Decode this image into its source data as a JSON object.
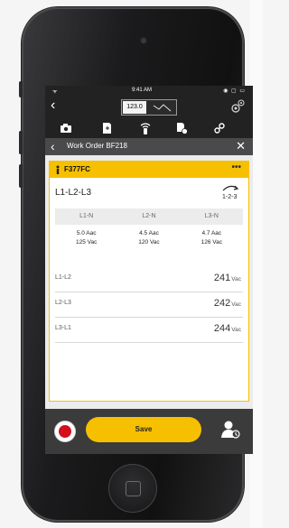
{
  "status_bar": {
    "left": "ᯤ",
    "time": "9:41 AM",
    "right": "◉ ▢ ▭"
  },
  "top_nav": {
    "meter_value": "123.0",
    "back_icon": "chevron-left-icon",
    "waveform_icon": "waveform-icon",
    "settings_icon": "gears-icon"
  },
  "toolbar": {
    "icons": [
      "camera-icon",
      "add-document-icon",
      "wireless-icon",
      "document-sync-icon",
      "link-icon"
    ]
  },
  "breadcrumb": {
    "title": "Work Order BF218"
  },
  "card": {
    "asset_name": "F377FC",
    "more": "•••",
    "phase_title": "L1-L2-L3",
    "rotation_label": "1-2-3",
    "phase_headers": [
      "L1-N",
      "L2-N",
      "L3-N"
    ],
    "phase_values": [
      {
        "current": "5.0 Aac",
        "voltage": "125 Vac"
      },
      {
        "current": "4.5 Aac",
        "voltage": "120 Vac"
      },
      {
        "current": "4.7 Aac",
        "voltage": "126 Vac"
      }
    ],
    "line_to_line": [
      {
        "label": "L1-L2",
        "value": "241",
        "unit": "Vac"
      },
      {
        "label": "L2-L3",
        "value": "242",
        "unit": "Vac"
      },
      {
        "label": "L3-L1",
        "value": "244",
        "unit": "Vac"
      }
    ]
  },
  "bottom_bar": {
    "save_label": "Save"
  },
  "colors": {
    "accent": "#f6c000",
    "record": "#d30f1c",
    "dark": "#222222"
  }
}
